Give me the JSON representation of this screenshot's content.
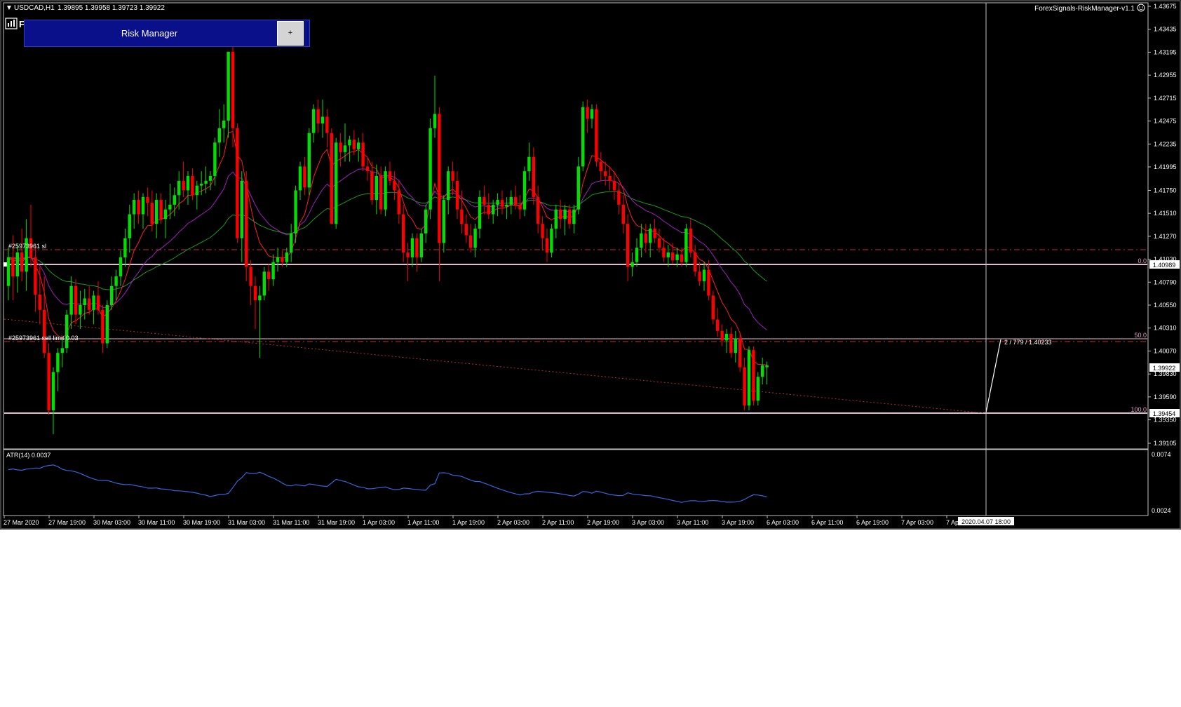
{
  "header": {
    "symbol": "USDCAD,H1",
    "ohlc": "1.39895 1.39958 1.39723 1.39922",
    "ea_name": "ForexSignals-RiskManager-v1.1"
  },
  "risk_manager": {
    "title": "Risk Manager",
    "plus_label": "+"
  },
  "price_axis": {
    "ticks": [
      "1.43675",
      "1.43435",
      "1.43195",
      "1.42955",
      "1.42715",
      "1.42475",
      "1.42235",
      "1.41995",
      "1.41750",
      "1.41510",
      "1.41270",
      "1.41030",
      "1.40790",
      "1.40550",
      "1.40310",
      "1.40070",
      "1.39830",
      "1.39590",
      "1.39350",
      "1.39105"
    ],
    "current_price": "1.39922",
    "sl_price": "1.40989",
    "low_price": "1.39454"
  },
  "levels": {
    "sl_label": "#25973961 sl",
    "limit_label": "#25973961 sell limit 0.03",
    "fib_0": "0.0",
    "fib_50": "50.0",
    "fib_100": "100.0",
    "measure_label": "2 / 779 / 1.40233"
  },
  "indicator": {
    "label": "ATR(14) 0.0037",
    "top_tick": "0.0074",
    "bottom_tick": "0.0024"
  },
  "time_axis": {
    "labels": [
      "27 Mar 2020",
      "27 Mar 19:00",
      "30 Mar 03:00",
      "30 Mar 11:00",
      "30 Mar 19:00",
      "31 Mar 03:00",
      "31 Mar 11:00",
      "31 Mar 19:00",
      "1 Apr 03:00",
      "1 Apr 11:00",
      "1 Apr 19:00",
      "2 Apr 03:00",
      "2 Apr 11:00",
      "2 Apr 19:00",
      "3 Apr 03:00",
      "3 Apr 11:00",
      "3 Apr 19:00",
      "6 Apr 03:00",
      "6 Apr 11:00",
      "6 Apr 19:00",
      "7 Apr 03:00",
      "7 Apr 11:00"
    ],
    "cursor_label": "2020.04.07 18:00"
  },
  "colors": {
    "bull": "#00e000",
    "bear": "#ff0000",
    "ma_fast": "#ff2020",
    "ma_mid": "#a020c0",
    "ma_slow": "#1a9a1a",
    "atr": "#3366dd",
    "background": "#000000"
  },
  "icons": {
    "menu_arrow": "triangle-down-icon",
    "smiley": "smiley-icon",
    "logo": "chart-bars-icon"
  },
  "chart_data": {
    "type": "candlestick",
    "ylim": [
      1.39105,
      1.43675
    ],
    "candles": [
      [
        1.4075,
        1.4115,
        1.406,
        1.4105
      ],
      [
        1.4105,
        1.4128,
        1.406,
        1.4085
      ],
      [
        1.4085,
        1.4118,
        1.4068,
        1.411
      ],
      [
        1.411,
        1.4135,
        1.408,
        1.409
      ],
      [
        1.409,
        1.4145,
        1.407,
        1.4125
      ],
      [
        1.4125,
        1.416,
        1.4095,
        1.4105
      ],
      [
        1.4105,
        1.4118,
        1.4048,
        1.4066
      ],
      [
        1.4066,
        1.4095,
        1.4035,
        1.405
      ],
      [
        1.405,
        1.4085,
        1.4,
        1.4005
      ],
      [
        1.4005,
        1.4015,
        1.394,
        1.3945
      ],
      [
        1.3945,
        1.399,
        1.392,
        1.3985
      ],
      [
        1.3985,
        1.401,
        1.3965,
        1.4005
      ],
      [
        1.4005,
        1.402,
        1.399,
        1.401
      ],
      [
        1.401,
        1.405,
        1.4005,
        1.4045
      ],
      [
        1.4045,
        1.4085,
        1.403,
        1.4075
      ],
      [
        1.4075,
        1.4082,
        1.4035,
        1.4045
      ],
      [
        1.4045,
        1.407,
        1.403,
        1.4055
      ],
      [
        1.4055,
        1.4072,
        1.404,
        1.4062
      ],
      [
        1.4062,
        1.4075,
        1.4045,
        1.405
      ],
      [
        1.405,
        1.407,
        1.4035,
        1.4065
      ],
      [
        1.4065,
        1.408,
        1.4045,
        1.405
      ],
      [
        1.405,
        1.4055,
        1.4005,
        1.4015
      ],
      [
        1.4015,
        1.406,
        1.401,
        1.4055
      ],
      [
        1.4055,
        1.4085,
        1.405,
        1.4075
      ],
      [
        1.4075,
        1.4092,
        1.406,
        1.4085
      ],
      [
        1.4085,
        1.4112,
        1.4075,
        1.4105
      ],
      [
        1.4105,
        1.4135,
        1.4095,
        1.4125
      ],
      [
        1.4125,
        1.416,
        1.411,
        1.415
      ],
      [
        1.415,
        1.4172,
        1.4135,
        1.4165
      ],
      [
        1.4165,
        1.4175,
        1.414,
        1.415
      ],
      [
        1.415,
        1.4172,
        1.4135,
        1.4168
      ],
      [
        1.4168,
        1.4178,
        1.4148,
        1.4162
      ],
      [
        1.4162,
        1.4175,
        1.4132,
        1.414
      ],
      [
        1.414,
        1.4172,
        1.4125,
        1.4165
      ],
      [
        1.4165,
        1.4172,
        1.414,
        1.4145
      ],
      [
        1.4145,
        1.4165,
        1.4125,
        1.4155
      ],
      [
        1.4155,
        1.4182,
        1.4145,
        1.416
      ],
      [
        1.416,
        1.4178,
        1.4148,
        1.417
      ],
      [
        1.417,
        1.4195,
        1.4155,
        1.4185
      ],
      [
        1.4185,
        1.4205,
        1.4168,
        1.4175
      ],
      [
        1.4175,
        1.4195,
        1.416,
        1.419
      ],
      [
        1.419,
        1.4198,
        1.4165,
        1.417
      ],
      [
        1.417,
        1.4185,
        1.4155,
        1.418
      ],
      [
        1.418,
        1.4195,
        1.417,
        1.4182
      ],
      [
        1.4182,
        1.42,
        1.4172,
        1.4185
      ],
      [
        1.4185,
        1.4195,
        1.4175,
        1.419
      ],
      [
        1.419,
        1.423,
        1.418,
        1.4225
      ],
      [
        1.4225,
        1.426,
        1.421,
        1.424
      ],
      [
        1.424,
        1.4265,
        1.4225,
        1.4248
      ],
      [
        1.4248,
        1.428,
        1.423,
        1.432
      ],
      [
        1.432,
        1.4332,
        1.422,
        1.424
      ],
      [
        1.424,
        1.4245,
        1.412,
        1.4125
      ],
      [
        1.4125,
        1.4195,
        1.41,
        1.4185
      ],
      [
        1.4185,
        1.4195,
        1.408,
        1.4095
      ],
      [
        1.4095,
        1.4102,
        1.4055,
        1.4075
      ],
      [
        1.4075,
        1.4085,
        1.403,
        1.406
      ],
      [
        1.406,
        1.4075,
        1.4,
        1.4065
      ],
      [
        1.4065,
        1.4095,
        1.406,
        1.409
      ],
      [
        1.409,
        1.4098,
        1.407,
        1.4082
      ],
      [
        1.4082,
        1.4108,
        1.4075,
        1.41
      ],
      [
        1.41,
        1.4115,
        1.409,
        1.4105
      ],
      [
        1.4105,
        1.4112,
        1.4095,
        1.41
      ],
      [
        1.41,
        1.4115,
        1.4095,
        1.411
      ],
      [
        1.411,
        1.414,
        1.41,
        1.413
      ],
      [
        1.413,
        1.418,
        1.412,
        1.4175
      ],
      [
        1.4175,
        1.4205,
        1.4165,
        1.42
      ],
      [
        1.42,
        1.421,
        1.417,
        1.4178
      ],
      [
        1.4178,
        1.424,
        1.417,
        1.4235
      ],
      [
        1.4235,
        1.4265,
        1.4225,
        1.426
      ],
      [
        1.426,
        1.427,
        1.4235,
        1.4245
      ],
      [
        1.4245,
        1.427,
        1.423,
        1.4252
      ],
      [
        1.4252,
        1.426,
        1.422,
        1.4235
      ],
      [
        1.4235,
        1.424,
        1.415,
        1.414
      ],
      [
        1.414,
        1.423,
        1.4135,
        1.4225
      ],
      [
        1.4225,
        1.4235,
        1.42,
        1.4215
      ],
      [
        1.4215,
        1.4245,
        1.4205,
        1.4222
      ],
      [
        1.4222,
        1.4232,
        1.4205,
        1.4228
      ],
      [
        1.4228,
        1.4238,
        1.4212,
        1.4218
      ],
      [
        1.4218,
        1.423,
        1.4205,
        1.4225
      ],
      [
        1.4225,
        1.4235,
        1.4195,
        1.42
      ],
      [
        1.42,
        1.421,
        1.4185,
        1.4195
      ],
      [
        1.4195,
        1.4205,
        1.416,
        1.4165
      ],
      [
        1.4165,
        1.4202,
        1.415,
        1.419
      ],
      [
        1.419,
        1.42,
        1.415,
        1.4155
      ],
      [
        1.4155,
        1.42,
        1.4148,
        1.4195
      ],
      [
        1.4195,
        1.4205,
        1.418,
        1.4185
      ],
      [
        1.4185,
        1.4195,
        1.4165,
        1.4175
      ],
      [
        1.4175,
        1.4185,
        1.414,
        1.415
      ],
      [
        1.415,
        1.416,
        1.41,
        1.411
      ],
      [
        1.411,
        1.412,
        1.408,
        1.4105
      ],
      [
        1.4105,
        1.413,
        1.4095,
        1.4125
      ],
      [
        1.4125,
        1.413,
        1.409,
        1.4105
      ],
      [
        1.4105,
        1.4135,
        1.41,
        1.413
      ],
      [
        1.413,
        1.416,
        1.412,
        1.4155
      ],
      [
        1.4155,
        1.425,
        1.4145,
        1.424
      ],
      [
        1.424,
        1.4295,
        1.423,
        1.4255
      ],
      [
        1.4255,
        1.4262,
        1.408,
        1.412
      ],
      [
        1.412,
        1.417,
        1.411,
        1.4165
      ],
      [
        1.4165,
        1.42,
        1.415,
        1.4195
      ],
      [
        1.4195,
        1.4205,
        1.417,
        1.4185
      ],
      [
        1.4185,
        1.4195,
        1.4145,
        1.4155
      ],
      [
        1.4155,
        1.4175,
        1.413,
        1.414
      ],
      [
        1.414,
        1.415,
        1.412,
        1.4128
      ],
      [
        1.4128,
        1.414,
        1.411,
        1.4115
      ],
      [
        1.4115,
        1.414,
        1.4105,
        1.4135
      ],
      [
        1.4135,
        1.4175,
        1.4125,
        1.4168
      ],
      [
        1.4168,
        1.418,
        1.415,
        1.416
      ],
      [
        1.416,
        1.4172,
        1.4145,
        1.415
      ],
      [
        1.415,
        1.4165,
        1.414,
        1.416
      ],
      [
        1.416,
        1.4172,
        1.4148,
        1.4165
      ],
      [
        1.4165,
        1.4175,
        1.415,
        1.4158
      ],
      [
        1.4158,
        1.4168,
        1.4145,
        1.416
      ],
      [
        1.416,
        1.4175,
        1.415,
        1.4168
      ],
      [
        1.4168,
        1.418,
        1.4155,
        1.416
      ],
      [
        1.416,
        1.417,
        1.4145,
        1.4155
      ],
      [
        1.4155,
        1.42,
        1.4148,
        1.4195
      ],
      [
        1.4195,
        1.4225,
        1.4185,
        1.421
      ],
      [
        1.421,
        1.422,
        1.416,
        1.4168
      ],
      [
        1.4168,
        1.418,
        1.413,
        1.414
      ],
      [
        1.414,
        1.4148,
        1.4112,
        1.4125
      ],
      [
        1.4125,
        1.4135,
        1.41,
        1.411
      ],
      [
        1.411,
        1.414,
        1.4105,
        1.4135
      ],
      [
        1.4135,
        1.416,
        1.4125,
        1.4155
      ],
      [
        1.4155,
        1.4165,
        1.4135,
        1.4145
      ],
      [
        1.4145,
        1.416,
        1.4128,
        1.4155
      ],
      [
        1.4155,
        1.416,
        1.4135,
        1.414
      ],
      [
        1.414,
        1.416,
        1.413,
        1.4155
      ],
      [
        1.4155,
        1.421,
        1.415,
        1.42
      ],
      [
        1.42,
        1.4268,
        1.4195,
        1.4262
      ],
      [
        1.4262,
        1.427,
        1.4235,
        1.425
      ],
      [
        1.425,
        1.4265,
        1.424,
        1.426
      ],
      [
        1.426,
        1.4265,
        1.42,
        1.4205
      ],
      [
        1.4205,
        1.4215,
        1.4185,
        1.4195
      ],
      [
        1.4195,
        1.4205,
        1.418,
        1.419
      ],
      [
        1.419,
        1.42,
        1.4175,
        1.4185
      ],
      [
        1.4185,
        1.4195,
        1.4165,
        1.4175
      ],
      [
        1.4175,
        1.4182,
        1.415,
        1.416
      ],
      [
        1.416,
        1.417,
        1.413,
        1.414
      ],
      [
        1.414,
        1.415,
        1.408,
        1.4095
      ],
      [
        1.4095,
        1.411,
        1.4085,
        1.41
      ],
      [
        1.41,
        1.4125,
        1.4095,
        1.4115
      ],
      [
        1.4115,
        1.414,
        1.4105,
        1.413
      ],
      [
        1.413,
        1.414,
        1.411,
        1.412
      ],
      [
        1.412,
        1.414,
        1.4105,
        1.4135
      ],
      [
        1.4135,
        1.4145,
        1.412,
        1.4125
      ],
      [
        1.4125,
        1.4135,
        1.411,
        1.4115
      ],
      [
        1.4115,
        1.4125,
        1.41,
        1.4105
      ],
      [
        1.4105,
        1.4118,
        1.4095,
        1.411
      ],
      [
        1.411,
        1.412,
        1.4098,
        1.4102
      ],
      [
        1.4102,
        1.4115,
        1.4095,
        1.4108
      ],
      [
        1.4108,
        1.4115,
        1.4095,
        1.41
      ],
      [
        1.41,
        1.414,
        1.4095,
        1.4135
      ],
      [
        1.4135,
        1.4145,
        1.4105,
        1.411
      ],
      [
        1.411,
        1.4118,
        1.4085,
        1.409
      ],
      [
        1.409,
        1.41,
        1.4075,
        1.408
      ],
      [
        1.408,
        1.41,
        1.407,
        1.4092
      ],
      [
        1.4092,
        1.4102,
        1.406,
        1.4065
      ],
      [
        1.4065,
        1.407,
        1.4035,
        1.404
      ],
      [
        1.404,
        1.4052,
        1.4022,
        1.4028
      ],
      [
        1.4028,
        1.4035,
        1.4012,
        1.4018
      ],
      [
        1.4018,
        1.403,
        1.4005,
        1.4025
      ],
      [
        1.4025,
        1.4032,
        1.4,
        1.4005
      ],
      [
        1.4005,
        1.4028,
        1.3995,
        1.402
      ],
      [
        1.402,
        1.4025,
        1.3985,
        1.399
      ],
      [
        1.399,
        1.4,
        1.3945,
        1.395
      ],
      [
        1.395,
        1.4012,
        1.3945,
        1.4008
      ],
      [
        1.4008,
        1.4012,
        1.395,
        1.3955
      ],
      [
        1.3955,
        1.3985,
        1.395,
        1.398
      ],
      [
        1.398,
        1.4,
        1.3972,
        1.3992
      ],
      [
        1.399,
        1.3996,
        1.3972,
        1.3992
      ]
    ]
  }
}
